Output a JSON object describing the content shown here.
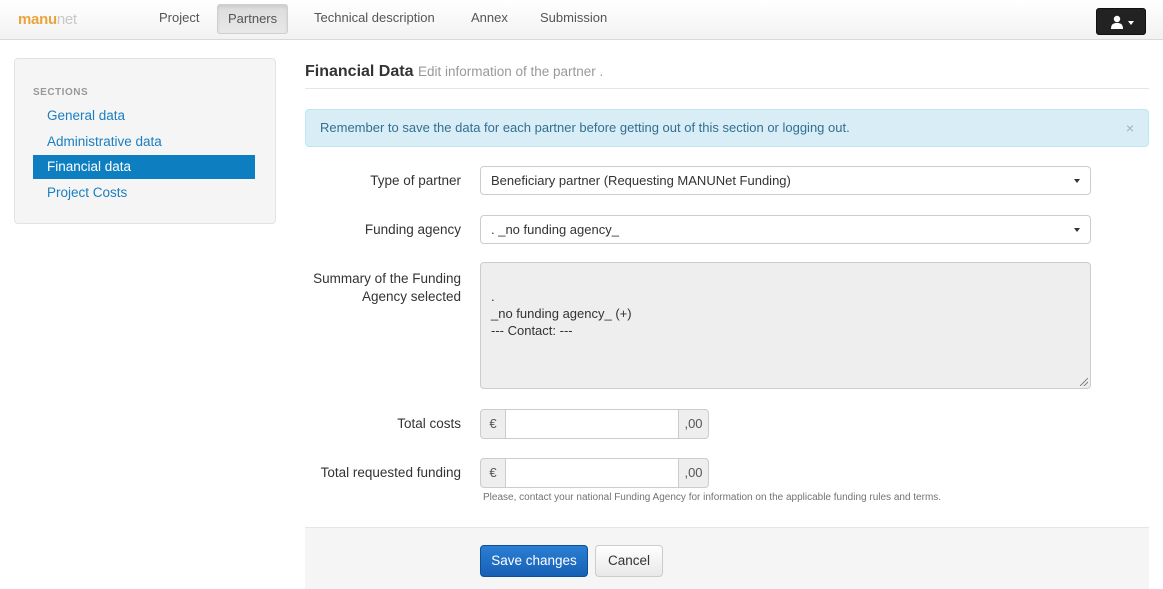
{
  "navbar": {
    "brand_part1": "manu",
    "brand_part2": "net",
    "items": [
      {
        "label": "Project"
      },
      {
        "label": "Partners"
      },
      {
        "label": "Technical description"
      },
      {
        "label": "Annex"
      },
      {
        "label": "Submission"
      }
    ],
    "active_item": "Partners",
    "user_icon": "user-icon"
  },
  "sidebar": {
    "header": "SECTIONS",
    "items": [
      {
        "label": "General data"
      },
      {
        "label": "Administrative data"
      },
      {
        "label": "Financial data"
      },
      {
        "label": "Project Costs"
      }
    ],
    "active_item": "Financial data"
  },
  "page": {
    "title": "Financial Data",
    "subtitle": "Edit information of the partner ."
  },
  "alert": {
    "message": "Remember to save the data for each partner before getting out of this section or logging out.",
    "close": "×"
  },
  "form": {
    "type_of_partner": {
      "label": "Type of partner",
      "value": "Beneficiary partner (Requesting MANUNet Funding)"
    },
    "funding_agency": {
      "label": "Funding agency",
      "value": ". _no funding agency_"
    },
    "summary": {
      "label_line1": "Summary of the Funding",
      "label_line2": "Agency selected",
      "value": ".\n_no funding agency_ (+)\n--- Contact: ---"
    },
    "total_costs": {
      "label": "Total costs",
      "prefix": "€",
      "value": "",
      "suffix": ",00"
    },
    "total_requested_funding": {
      "label": "Total requested funding",
      "prefix": "€",
      "value": "",
      "suffix": ",00"
    },
    "help_text": "Please, contact your national Funding Agency for information on the applicable funding rules and terms."
  },
  "buttons": {
    "save": "Save changes",
    "cancel": "Cancel"
  },
  "colors": {
    "brand_orange": "#e9a53a",
    "link_blue": "#1a7ec0",
    "active_blue": "#0d7fc0",
    "alert_bg": "#d9edf7",
    "primary_button": "#1761b5"
  }
}
